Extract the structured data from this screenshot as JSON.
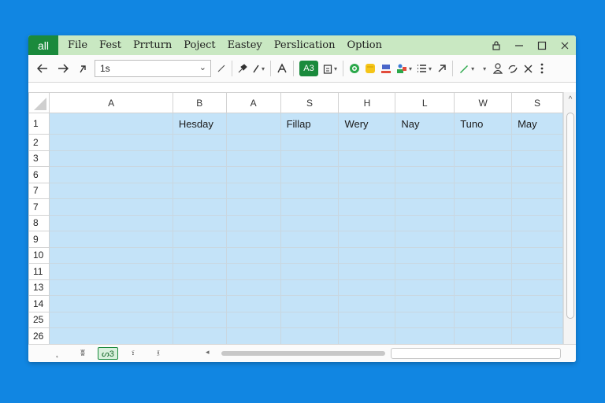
{
  "app": {
    "logo": "all"
  },
  "menu": [
    "File",
    "Fest",
    "Prrturn",
    "Poject",
    "Eastey",
    "Perslication",
    "Option"
  ],
  "window_controls": {
    "lock": "🔒",
    "minimize": "—",
    "maximize": "☐",
    "close": "✕"
  },
  "toolbar": {
    "back": "←",
    "forward": "→",
    "undo": "↶",
    "namebox_value": "1s",
    "namebox_arrow": "⌄",
    "fx": "✓",
    "paint": "🖌",
    "pen": "✎",
    "font": "A̶",
    "green_btn": "A3",
    "paste": "📋",
    "circle": "◎",
    "note": "🗒",
    "fill": "▤",
    "people": "⚑",
    "list": "☰",
    "link": "🔗",
    "pencil": "✏",
    "more_down": "▾",
    "user": "👤",
    "share": "⤴",
    "x": "✕",
    "kebab": "⋮"
  },
  "columns": [
    "A",
    "B",
    "A",
    "S",
    "H",
    "L",
    "W",
    "S"
  ],
  "rows": [
    {
      "num": "1",
      "cells": [
        "",
        "Hesday",
        "",
        "Fillap",
        "Wery",
        "Nay",
        "Tuno",
        "May"
      ]
    },
    {
      "num": "2",
      "cells": [
        "",
        "",
        "",
        "",
        "",
        "",
        "",
        ""
      ]
    },
    {
      "num": "3",
      "cells": [
        "",
        "",
        "",
        "",
        "",
        "",
        "",
        ""
      ]
    },
    {
      "num": "6",
      "cells": [
        "",
        "",
        "",
        "",
        "",
        "",
        "",
        ""
      ]
    },
    {
      "num": "7",
      "cells": [
        "",
        "",
        "",
        "",
        "",
        "",
        "",
        ""
      ]
    },
    {
      "num": "7",
      "cells": [
        "",
        "",
        "",
        "",
        "",
        "",
        "",
        ""
      ]
    },
    {
      "num": "8",
      "cells": [
        "",
        "",
        "",
        "",
        "",
        "",
        "",
        ""
      ]
    },
    {
      "num": "9",
      "cells": [
        "",
        "",
        "",
        "",
        "",
        "",
        "",
        ""
      ]
    },
    {
      "num": "10",
      "cells": [
        "",
        "",
        "",
        "",
        "",
        "",
        "",
        ""
      ]
    },
    {
      "num": "11",
      "cells": [
        "",
        "",
        "",
        "",
        "",
        "",
        "",
        ""
      ]
    },
    {
      "num": "13",
      "cells": [
        "",
        "",
        "",
        "",
        "",
        "",
        "",
        ""
      ]
    },
    {
      "num": "14",
      "cells": [
        "",
        "",
        "",
        "",
        "",
        "",
        "",
        ""
      ]
    },
    {
      "num": "25",
      "cells": [
        "",
        "",
        "",
        "",
        "",
        "",
        "",
        ""
      ]
    },
    {
      "num": "26",
      "cells": [
        "",
        "",
        "",
        "",
        "",
        "",
        "",
        ""
      ]
    }
  ],
  "bottom": {
    "btn1": "˛",
    "btn2": "ʬ",
    "active_sheet": "ᔕ3",
    "btn4": "፣",
    "btn5": "፤",
    "scroll_left": "◂",
    "scroll_right": "▹"
  },
  "colors": {
    "background": "#1186e2",
    "accent": "#1a8a3c",
    "titlebar": "#c9e8c2",
    "cell_fill": "#c4e3f8"
  }
}
